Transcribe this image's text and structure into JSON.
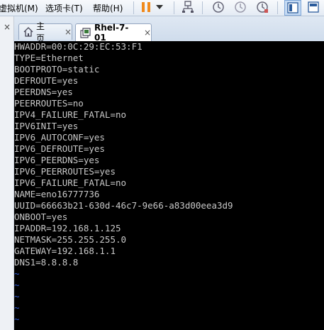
{
  "menu": {
    "items": [
      "虚拟机(M)",
      "选项卡(T)",
      "帮助(H)"
    ]
  },
  "toolbar": {
    "icons": [
      "pause-icon",
      "dropdown-arrow-icon",
      "network-icon",
      "snapshot-take-icon",
      "snapshot-restore-icon",
      "snapshot-manager-icon",
      "view-console-icon",
      "view-fullscreen-icon"
    ]
  },
  "tabs": [
    {
      "label": "主页",
      "icon": "home-icon",
      "active": false
    },
    {
      "label": "Rhel-7-01",
      "icon": "vm-icon",
      "active": true
    }
  ],
  "close_glyph": "×",
  "terminal": {
    "lines": [
      "HWADDR=00:0C:29:EC:53:F1",
      "TYPE=Ethernet",
      "BOOTPROTO=static",
      "DEFROUTE=yes",
      "PEERDNS=yes",
      "PEERROUTES=no",
      "IPV4_FAILURE_FATAL=no",
      "IPV6INIT=yes",
      "IPV6_AUTOCONF=yes",
      "IPV6_DEFROUTE=yes",
      "IPV6_PEERDNS=yes",
      "IPV6_PEERROUTES=yes",
      "IPV6_FAILURE_FATAL=no",
      "NAME=eno16777736",
      "UUID=66663b21-630d-46c7-9e66-a83d00eea3d9",
      "ONBOOT=yes",
      "IPADDR=192.168.1.125",
      "NETMASK=255.255.255.0",
      "GATEWAY=192.168.1.1",
      "DNS1=8.8.8.8"
    ],
    "empty_line_marker": "~",
    "text_color": "#c8c8c8",
    "tilde_color": "#2f5bd8",
    "background": "#000000"
  }
}
